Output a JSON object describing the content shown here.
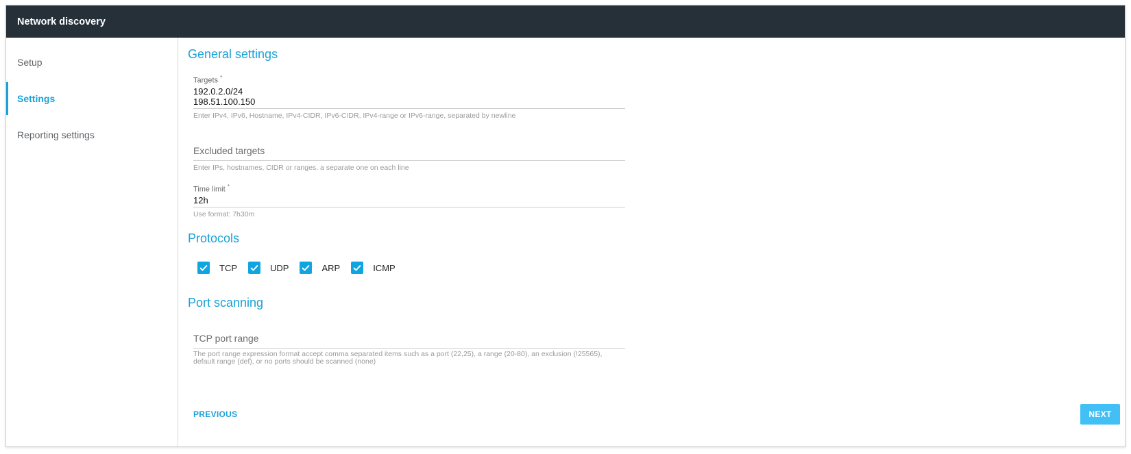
{
  "window": {
    "title": "Network discovery"
  },
  "sidebar": {
    "items": [
      {
        "label": "Setup"
      },
      {
        "label": "Settings"
      },
      {
        "label": "Reporting settings"
      }
    ],
    "active": "Settings"
  },
  "general": {
    "title": "General settings",
    "targets": {
      "label": "Targets",
      "required_mark": "*",
      "values": [
        "192.0.2.0/24",
        "198.51.100.150"
      ],
      "helper": "Enter IPv4, IPv6, Hostname, IPv4-CIDR, IPv6-CIDR, IPv4-range or IPv6-range, separated by newline"
    },
    "excluded": {
      "placeholder": "Excluded targets",
      "helper": "Enter IPs, hostnames, CIDR or ranges, a separate one on each line"
    },
    "time_limit": {
      "label": "Time limit",
      "required_mark": "*",
      "value": "12h",
      "helper": "Use format: 7h30m"
    }
  },
  "protocols": {
    "title": "Protocols",
    "items": [
      {
        "label": "TCP",
        "checked": true
      },
      {
        "label": "UDP",
        "checked": true
      },
      {
        "label": "ARP",
        "checked": true
      },
      {
        "label": "ICMP",
        "checked": true
      }
    ]
  },
  "port_scanning": {
    "title": "Port scanning",
    "tcp_range": {
      "placeholder": "TCP port range",
      "helper": "The port range expression format accept comma separated items such as a port (22,25), a range (20-80), an exclusion (!25565), default range (def), or no ports should be scanned (none)"
    }
  },
  "footer": {
    "previous_label": "PREVIOUS",
    "next_label": "NEXT"
  },
  "colors": {
    "accent": "#1ba1d8",
    "titlebar": "#263038",
    "checkbox": "#0ea5e0",
    "next_button": "#42c0f5"
  }
}
